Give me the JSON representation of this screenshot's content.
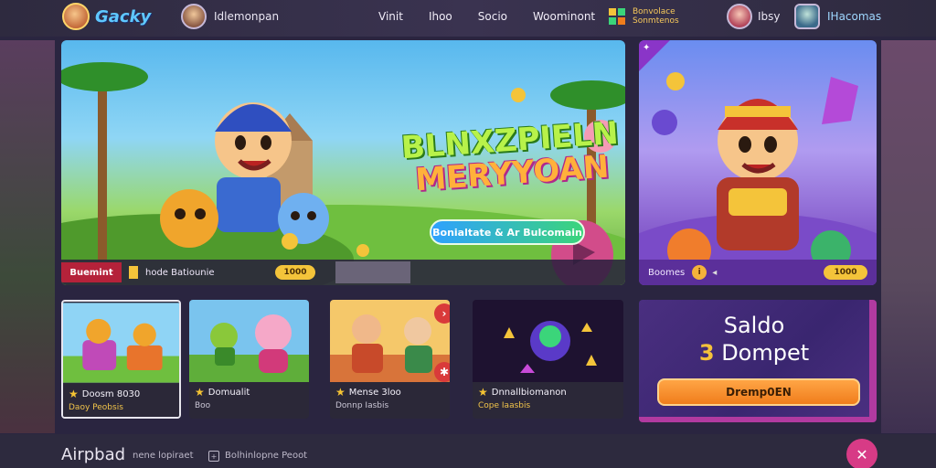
{
  "header": {
    "logo_text": "Gacky",
    "user_name": "Idlemonpan",
    "nav": [
      "Vinit",
      "Ihoo",
      "Socio",
      "Woominont"
    ],
    "promo_text": "Bonvolace Sonmtenos",
    "friend_name": "Ibsy",
    "account_name": "IHacomas"
  },
  "hero": {
    "title_line1": "BLNXZPIELN",
    "title_line2": "MERYYOAN",
    "cta_label": "Bonialtate & Ar Bulcomain",
    "bar_tag": "Buemint",
    "bar_text": "hode Batiounie",
    "bar_pill": "1000"
  },
  "hero2": {
    "bar_text": "Boomes",
    "pill": "1000"
  },
  "tiles": [
    {
      "title": "Doosm 8030",
      "sub": "Daoy Peobsis"
    },
    {
      "title": "Domualit",
      "sub": "Boo"
    },
    {
      "title": "Mense 3loo",
      "sub": "Donnp Iasbis"
    },
    {
      "title": "Dnnallbiomanon",
      "sub": "Cope Iaasbis"
    }
  ],
  "wallet": {
    "title": "Saldo",
    "amount_num": "3",
    "amount_text": "Dompet",
    "button": "Dremp0EN"
  },
  "footer": {
    "title": "Airpbad",
    "sub": "nene lopiraet",
    "link": "Bolhinlopne Peoot"
  },
  "colors": {
    "background": "#2a2540",
    "accent_orange": "#f07d1c",
    "accent_gold": "#f4c43a",
    "wallet_purple": "#4a2f80"
  }
}
